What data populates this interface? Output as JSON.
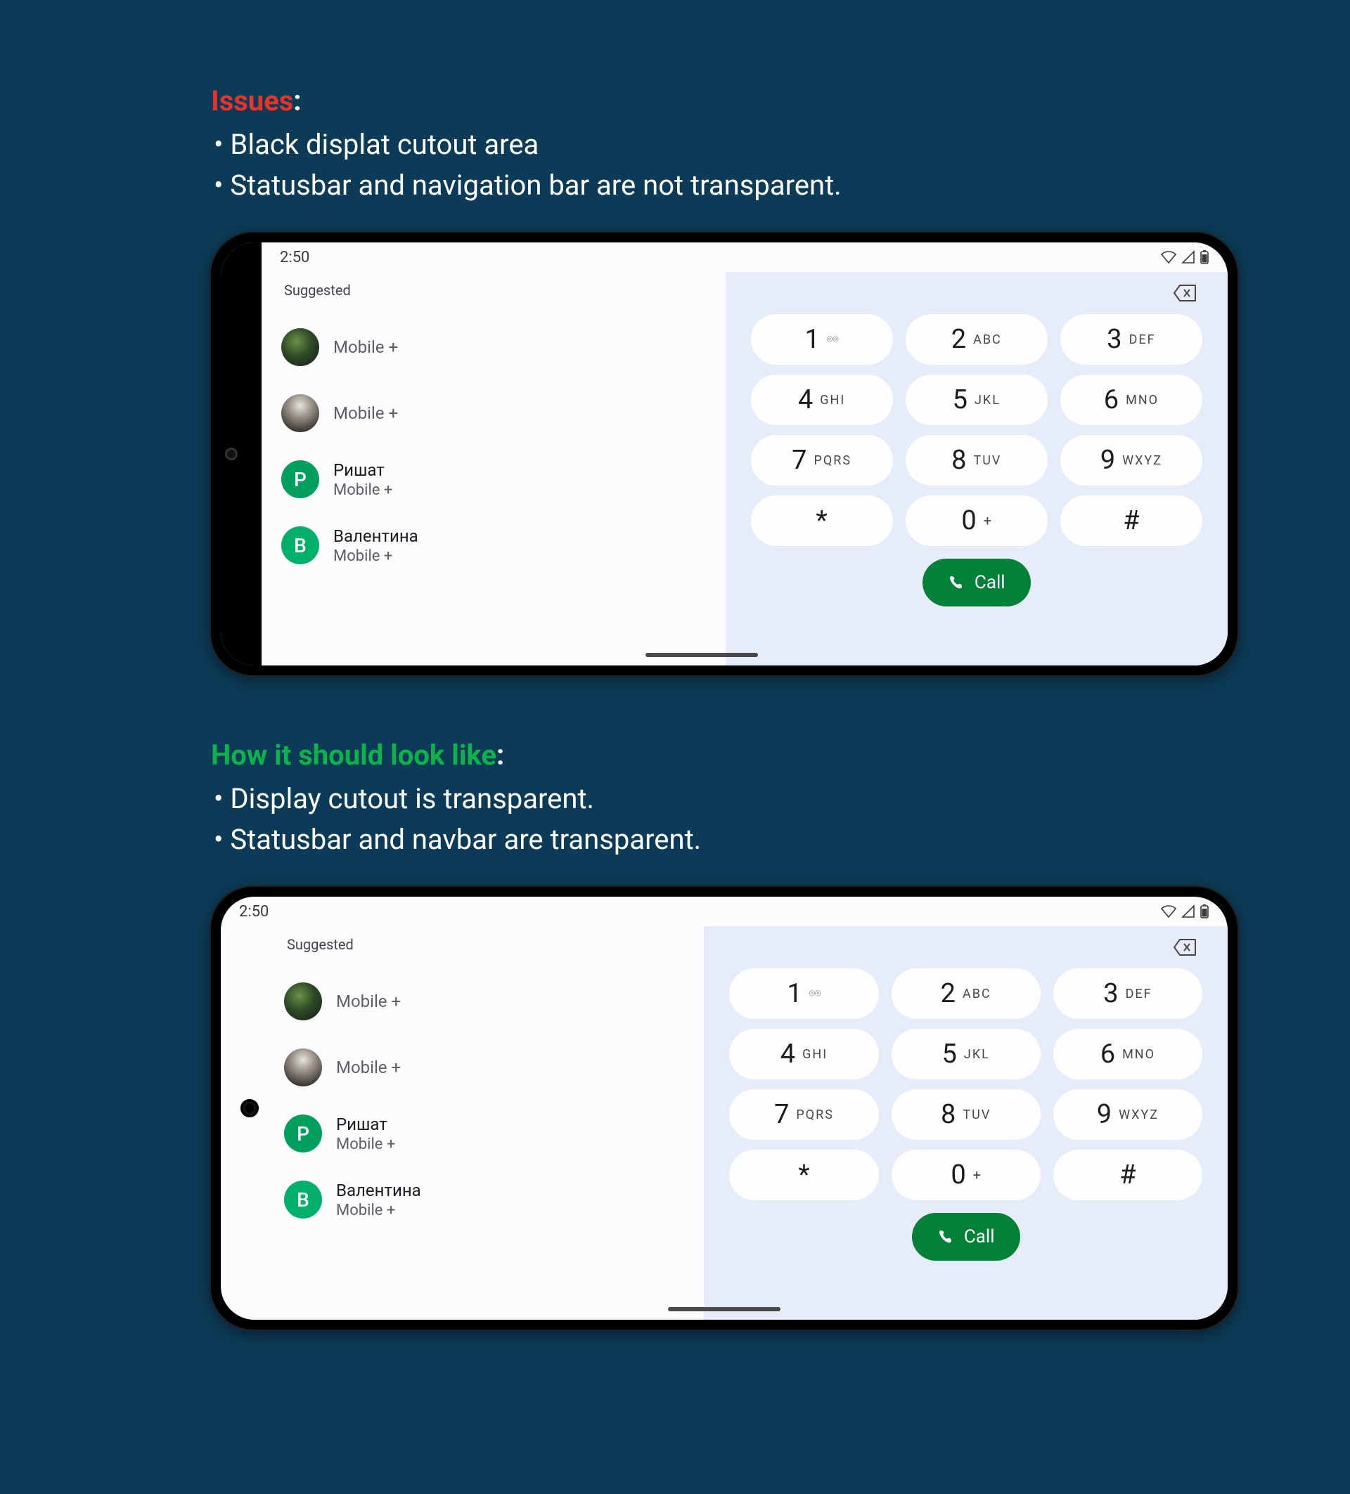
{
  "section1": {
    "title": "Issues",
    "bullets": [
      "Black displat cutout area",
      "Statusbar and navigation bar are not transparent."
    ]
  },
  "section2": {
    "title": "How it should look like",
    "bullets": [
      "Display cutout is transparent.",
      "Statusbar and navbar are transparent."
    ]
  },
  "status": {
    "time": "2:50"
  },
  "contacts": {
    "heading": "Suggested",
    "items": [
      {
        "name": "",
        "sub": "Mobile +",
        "avatar": "img1",
        "letter": ""
      },
      {
        "name": "",
        "sub": "Mobile +",
        "avatar": "img2",
        "letter": ""
      },
      {
        "name": "Ришат",
        "sub": "Mobile +",
        "avatar": "letter-p",
        "letter": "Р"
      },
      {
        "name": "Валентина",
        "sub": "Mobile +",
        "avatar": "letter-b",
        "letter": "В"
      }
    ]
  },
  "dialpad": {
    "keys": [
      {
        "digit": "1",
        "letters": "",
        "extra": "vm"
      },
      {
        "digit": "2",
        "letters": "ABC"
      },
      {
        "digit": "3",
        "letters": "DEF"
      },
      {
        "digit": "4",
        "letters": "GHI"
      },
      {
        "digit": "5",
        "letters": "JKL"
      },
      {
        "digit": "6",
        "letters": "MNO"
      },
      {
        "digit": "7",
        "letters": "PQRS"
      },
      {
        "digit": "8",
        "letters": "TUV"
      },
      {
        "digit": "9",
        "letters": "WXYZ"
      },
      {
        "digit": "*",
        "letters": ""
      },
      {
        "digit": "0",
        "letters": "",
        "extra": "plus"
      },
      {
        "digit": "#",
        "letters": ""
      }
    ],
    "call_label": "Call"
  }
}
